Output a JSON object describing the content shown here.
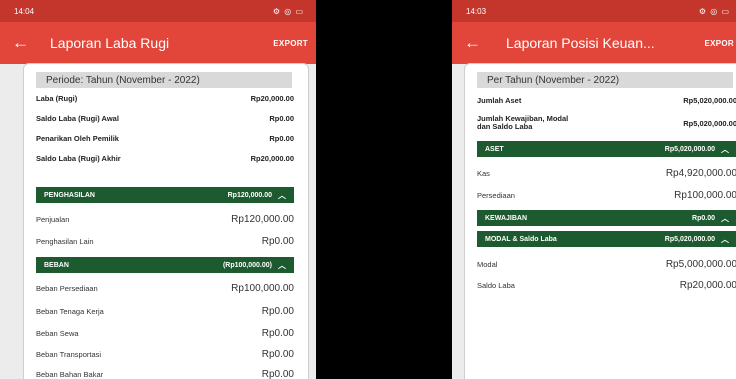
{
  "left": {
    "status": {
      "time": "14:04",
      "icons": "⚙ ◎ ▭"
    },
    "appbar": {
      "title": "Laporan Laba Rugi",
      "export": "EXPORT"
    },
    "period": "Periode: Tahun (November - 2022)",
    "summary": [
      {
        "label": "Laba (Rugi)",
        "value": "Rp20,000.00"
      },
      {
        "label": "Saldo Laba (Rugi) Awal",
        "value": "Rp0.00"
      },
      {
        "label": "Penarikan Oleh Pemilik",
        "value": "Rp0.00"
      },
      {
        "label": "Saldo Laba (Rugi) Akhir",
        "value": "Rp20,000.00"
      }
    ],
    "income": {
      "label": "PENGHASILAN",
      "total": "Rp120,000.00",
      "items": [
        {
          "label": "Penjualan",
          "value": "Rp120,000.00"
        },
        {
          "label": "Penghasilan Lain",
          "value": "Rp0.00"
        }
      ]
    },
    "expense": {
      "label": "BEBAN",
      "total": "(Rp100,000.00)",
      "items": [
        {
          "label": "Beban Persediaan",
          "value": "Rp100,000.00"
        },
        {
          "label": "Beban Tenaga Kerja",
          "value": "Rp0.00"
        },
        {
          "label": "Beban Sewa",
          "value": "Rp0.00"
        },
        {
          "label": "Beban Transportasi",
          "value": "Rp0.00"
        },
        {
          "label": "Beban Bahan Bakar",
          "value": "Rp0.00"
        }
      ]
    }
  },
  "right": {
    "status": {
      "time": "14:03",
      "icons": "⚙ ◎ ▭"
    },
    "appbar": {
      "title": "Laporan Posisi Keuan...",
      "export": "EXPOR"
    },
    "period": "Per Tahun (November - 2022)",
    "summary": [
      {
        "label": "Jumlah Aset",
        "value": "Rp5,020,000.00"
      },
      {
        "label": "Jumlah Kewajiban, Modal",
        "label2": "dan Saldo Laba",
        "value": "Rp5,020,000.00"
      }
    ],
    "assets": {
      "label": "ASET",
      "total": "Rp5,020,000.00",
      "items": [
        {
          "label": "Kas",
          "value": "Rp4,920,000.00"
        },
        {
          "label": "Persediaan",
          "value": "Rp100,000.00"
        }
      ]
    },
    "liabilities": {
      "label": "KEWAJIBAN",
      "total": "Rp0.00"
    },
    "equity": {
      "label": "MODAL & Saldo Laba",
      "total": "Rp5,020,000.00",
      "items": [
        {
          "label": "Modal",
          "value": "Rp5,000,000.00"
        },
        {
          "label": "Saldo Laba",
          "value": "Rp20,000.00"
        }
      ]
    }
  },
  "colors": {
    "statusbar": "#c4352b",
    "appbar": "#e2463b",
    "section": "#1e5a2f",
    "background": "#ececec"
  }
}
